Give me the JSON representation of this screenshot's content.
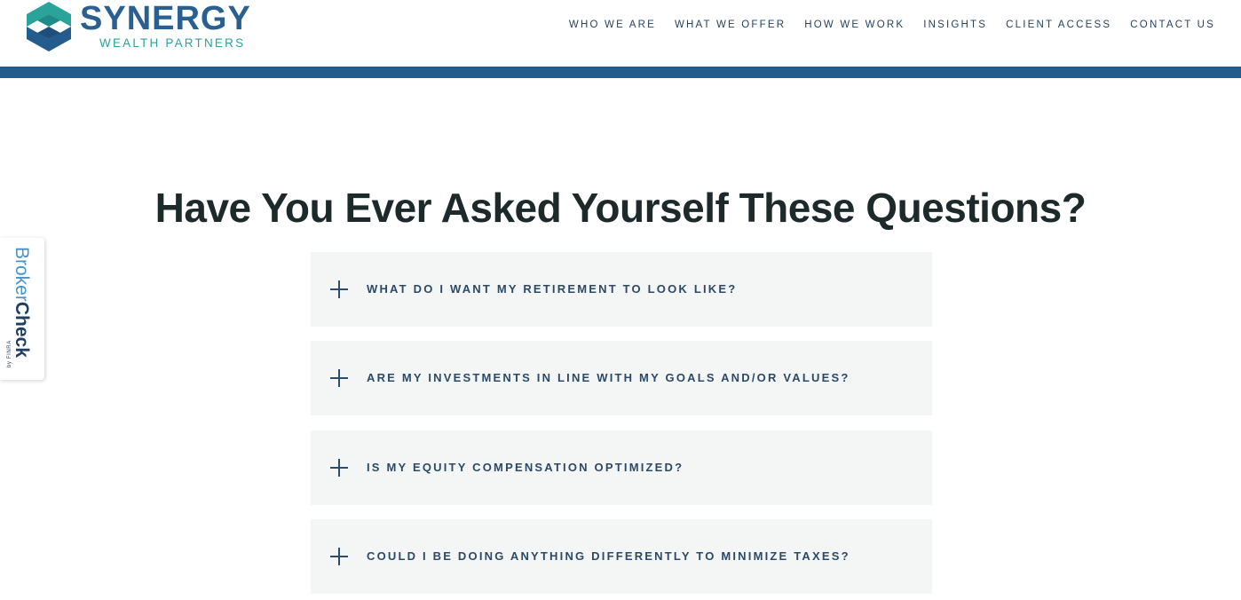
{
  "brand": {
    "name": "SYNERGY",
    "tagline": "WEALTH PARTNERS",
    "colors": {
      "primary": "#245c8e",
      "accent": "#2aa39a",
      "dark_text": "#1d2a2b"
    }
  },
  "nav": {
    "items": [
      {
        "label": "WHO WE ARE"
      },
      {
        "label": "WHAT WE OFFER"
      },
      {
        "label": "HOW WE WORK"
      },
      {
        "label": "INSIGHTS"
      },
      {
        "label": "CLIENT ACCESS"
      },
      {
        "label": "CONTACT US"
      }
    ]
  },
  "brokercheck": {
    "label_broker": "Broker",
    "label_check": "Check",
    "label_finra": "by FINRA"
  },
  "main": {
    "heading": "Have You Ever Asked Yourself These Questions?",
    "faqs": [
      {
        "question": "WHAT DO I WANT MY RETIREMENT TO LOOK LIKE?",
        "icon": "plus-icon"
      },
      {
        "question": "ARE MY INVESTMENTS IN LINE WITH MY GOALS AND/OR VALUES?",
        "icon": "plus-icon"
      },
      {
        "question": "IS MY EQUITY COMPENSATION OPTIMIZED?",
        "icon": "plus-icon"
      },
      {
        "question": "COULD I BE DOING ANYTHING DIFFERENTLY TO MINIMIZE TAXES?",
        "icon": "plus-icon"
      }
    ]
  }
}
